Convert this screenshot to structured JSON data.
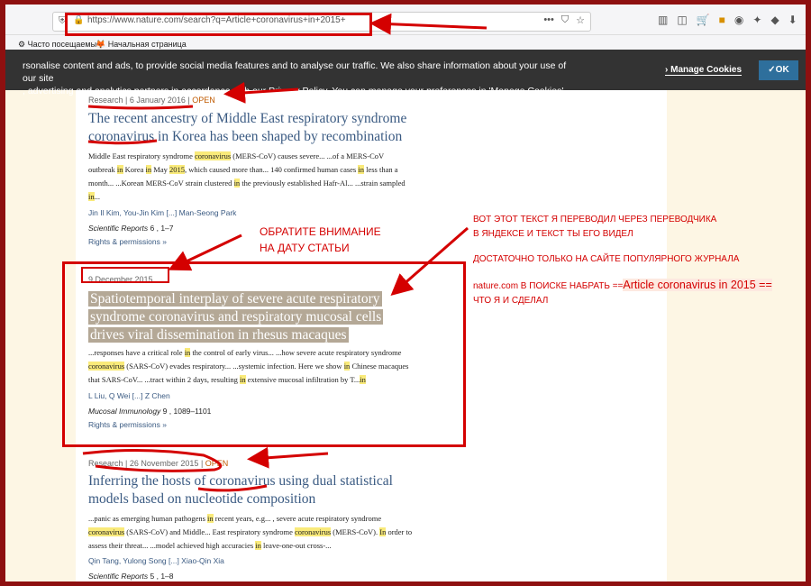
{
  "browser": {
    "url": "https://www.nature.com/search?q=Article+coronavirus+in+2015+",
    "url_actions": [
      "•••",
      "⛉",
      "☆"
    ],
    "bookmarks": [
      "Часто посещаемые",
      "Начальная страница"
    ]
  },
  "cookie_banner": {
    "line1": "rsonalise content and ads, to provide social media features and to analyse our traffic. We also share information about your use of our site",
    "line2_pre": ", advertising and analytics partners in accordance with our ",
    "privacy_link": "Privacy Policy",
    "line2_post": ". You can manage your preferences in 'Manage Cookies'.",
    "manage_label": "Manage Cookies",
    "ok_label": "✓OK"
  },
  "results": [
    {
      "type": "Research",
      "date": "6 January 2016",
      "open": "OPEN",
      "title_lines": [
        "The recent ancestry of Middle East respiratory syndrome",
        "coronavirus in Korea has been shaped by recombination"
      ],
      "snippet_lines": [
        [
          "Middle East respiratory syndrome ",
          {
            "kw": "coronavirus"
          },
          " (MERS-CoV) causes severe... ...of a MERS-CoV"
        ],
        [
          "outbreak ",
          {
            "kw": "in"
          },
          " Korea ",
          {
            "kw": "in"
          },
          " May ",
          {
            "kw": "2015"
          },
          ", which caused more than... 140 confirmed human cases ",
          {
            "kw": "in"
          },
          " less than a"
        ],
        [
          "month... ...Korean MERS-CoV strain clustered ",
          {
            "kw": "in"
          },
          " the previously established Hafr-Al... ...strain sampled"
        ],
        [
          {
            "kw": "in"
          },
          "..."
        ]
      ],
      "authors": "Jin Il Kim, You-Jin Kim  [...]  Man-Seong Park",
      "journal": "Scientific Reports",
      "volume": " 6 , 1–7",
      "rights": "Rights & permissions »"
    },
    {
      "type": "",
      "date": "9 December 2015",
      "open": "",
      "title_lines": [
        "Spatiotemporal interplay of severe acute respiratory",
        "syndrome coronavirus and respiratory mucosal cells",
        "drives viral dissemination in rhesus macaques"
      ],
      "snippet_lines": [
        [
          "...responses have a critical role ",
          {
            "kw": "in"
          },
          " the control of early virus... ...how severe acute respiratory syndrome"
        ],
        [
          {
            "kw": "coronavirus"
          },
          " (SARS-CoV) evades respiratory... ...systemic infection. Here we show ",
          {
            "kw": "in"
          },
          " Chinese macaques"
        ],
        [
          "that SARS-CoV... ...tract within 2 days, resulting ",
          {
            "kw": "in"
          },
          " extensive mucosal infiltration by T...",
          {
            "kw": "in"
          }
        ]
      ],
      "authors": "L Liu, Q Wei  [...]  Z Chen",
      "journal": "Mucosal Immunology",
      "volume": " 9 , 1089–1101",
      "rights": "Rights & permissions »"
    },
    {
      "type": "Research",
      "date": "26 November 2015",
      "open": "OPEN",
      "title_lines": [
        "Inferring the hosts of coronavirus using dual statistical",
        "models based on nucleotide composition"
      ],
      "snippet_lines": [
        [
          "...panic as emerging human pathogens ",
          {
            "kw": "in"
          },
          " recent years, e.g... , severe acute respiratory syndrome"
        ],
        [
          {
            "kw": "coronavirus"
          },
          " (SARS-CoV) and Middle... East respiratory syndrome ",
          {
            "kw": "coronavirus"
          },
          " (MERS-CoV). ",
          {
            "kw": "In"
          },
          " order to"
        ],
        [
          "assess their threat... ...model achieved high accuracies ",
          {
            "kw": "in"
          },
          " leave-one-out cross-..."
        ]
      ],
      "authors": "Qin Tang, Yulong Song  [...]  Xiao-Qin Xia",
      "journal": "Scientific Reports",
      "volume": " 5 , 1–8",
      "rights": ""
    }
  ],
  "annotations": {
    "date_note": [
      "ОБРАТИТЕ ВНИМАНИЕ",
      "НА  ДАТУ  СТАТЬИ"
    ],
    "translate_note": [
      "ВОТ ЭТОТ ТЕКСТ Я ПЕРЕВОДИЛ ЧЕРЕЗ ПЕРЕВОДЧИКА",
      "В ЯНДЕКСЕ И ТЕКСТ ТЫ ЕГО ВИДЕЛ"
    ],
    "journal_note": "ДОСТАТОЧНО ТОЛЬКО НА САЙТЕ ПОПУЛЯРНОГО ЖУРНАЛА",
    "search_note_pre": "nature.com  В ПОИСКЕ НАБРАТЬ ==",
    "search_query": "Article coronavirus  in  2015 ==",
    "search_note_end": "ЧТО Я  И  СДЕЛАЛ"
  },
  "colors": {
    "frame": "#8e1010",
    "annotation_red": "#d40000",
    "link": "#3a5a82",
    "highlight": "#f9ea7a"
  }
}
